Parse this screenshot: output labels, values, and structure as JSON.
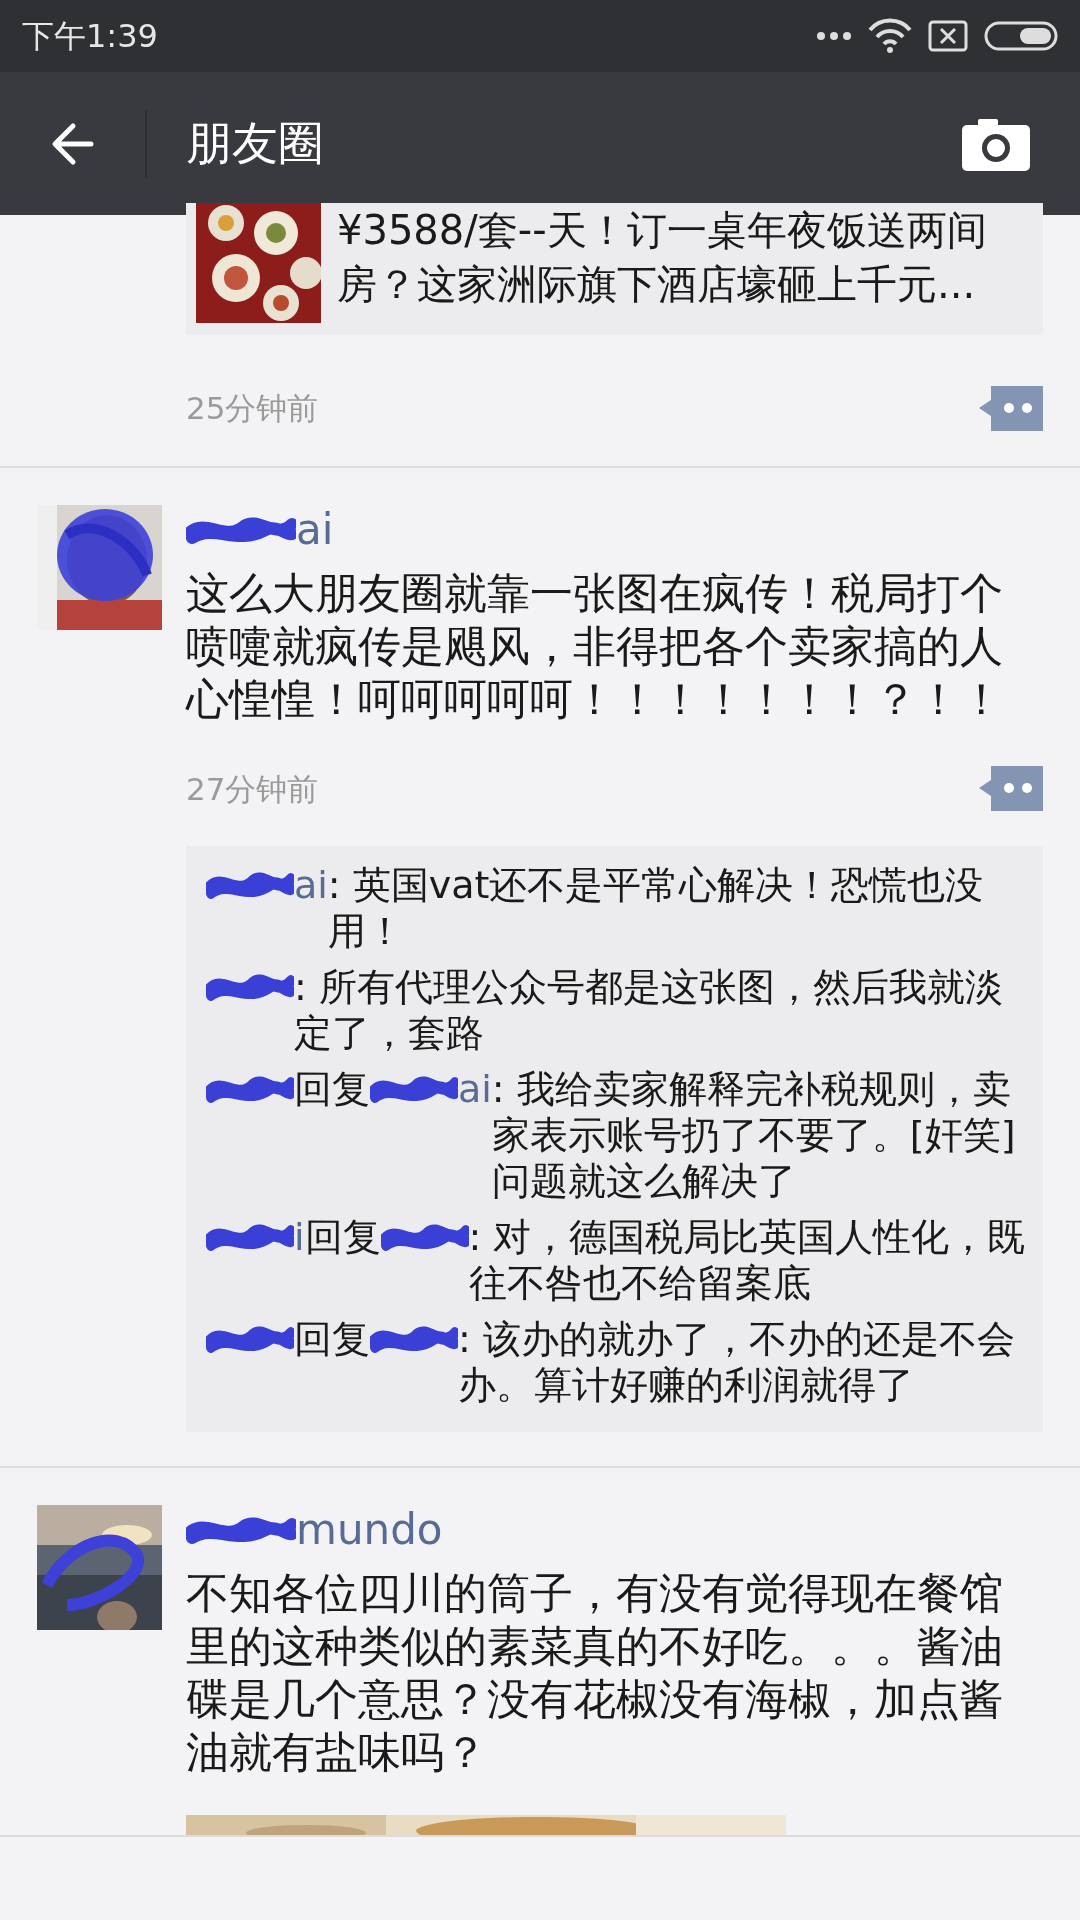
{
  "status_bar": {
    "time": "下午1:39"
  },
  "nav": {
    "title": "朋友圈"
  },
  "posts": [
    {
      "kind": "link",
      "link": {
        "title": "¥3588/套--天！订一桌年夜饭送两间房？这家洲际旗下酒店壕砸上千元..."
      },
      "time": "25分钟前"
    },
    {
      "kind": "text",
      "name": {
        "redacted": true,
        "visible": "ai"
      },
      "text": "这么大朋友圈就靠一张图在疯传！税局打个喷嚏就疯传是飓风，非得把各个卖家搞的人心惶惶！呵呵呵呵呵！！！！！！！？！！",
      "time": "27分钟前",
      "comments": [
        {
          "author": {
            "redacted": true,
            "visible": "ai"
          },
          "text": ": 英国vat还不是平常心解决！恐慌也没用！"
        },
        {
          "author": {
            "redacted": true
          },
          "text": ": 所有代理公众号都是这张图，然后我就淡定了，套路"
        },
        {
          "author": {
            "redacted": true
          },
          "reply_label": "回复",
          "reply_to": {
            "redacted": true,
            "visible": "ai"
          },
          "text": ": 我给卖家解释完补税规则，卖家表示账号扔了不要了。[奸笑]问题就这么解决了"
        },
        {
          "author": {
            "redacted": true,
            "visible": "i"
          },
          "reply_label": "回复",
          "reply_to": {
            "redacted": true
          },
          "text": ": 对，德国税局比英国人性化，既往不咎也不给留案底"
        },
        {
          "author": {
            "redacted": true
          },
          "reply_label": "回复",
          "reply_to": {
            "redacted": true
          },
          "text": ": 该办的就办了，不办的还是不会办。算计好赚的利润就得了"
        }
      ]
    },
    {
      "kind": "text",
      "name": {
        "redacted": true,
        "visible": "mundo"
      },
      "text": "不知各位四川的筒子，有没有觉得现在餐馆里的这种类似的素菜真的不好吃。。。酱油碟是几个意思？没有花椒没有海椒，加点酱油就有盐味吗？"
    }
  ]
}
